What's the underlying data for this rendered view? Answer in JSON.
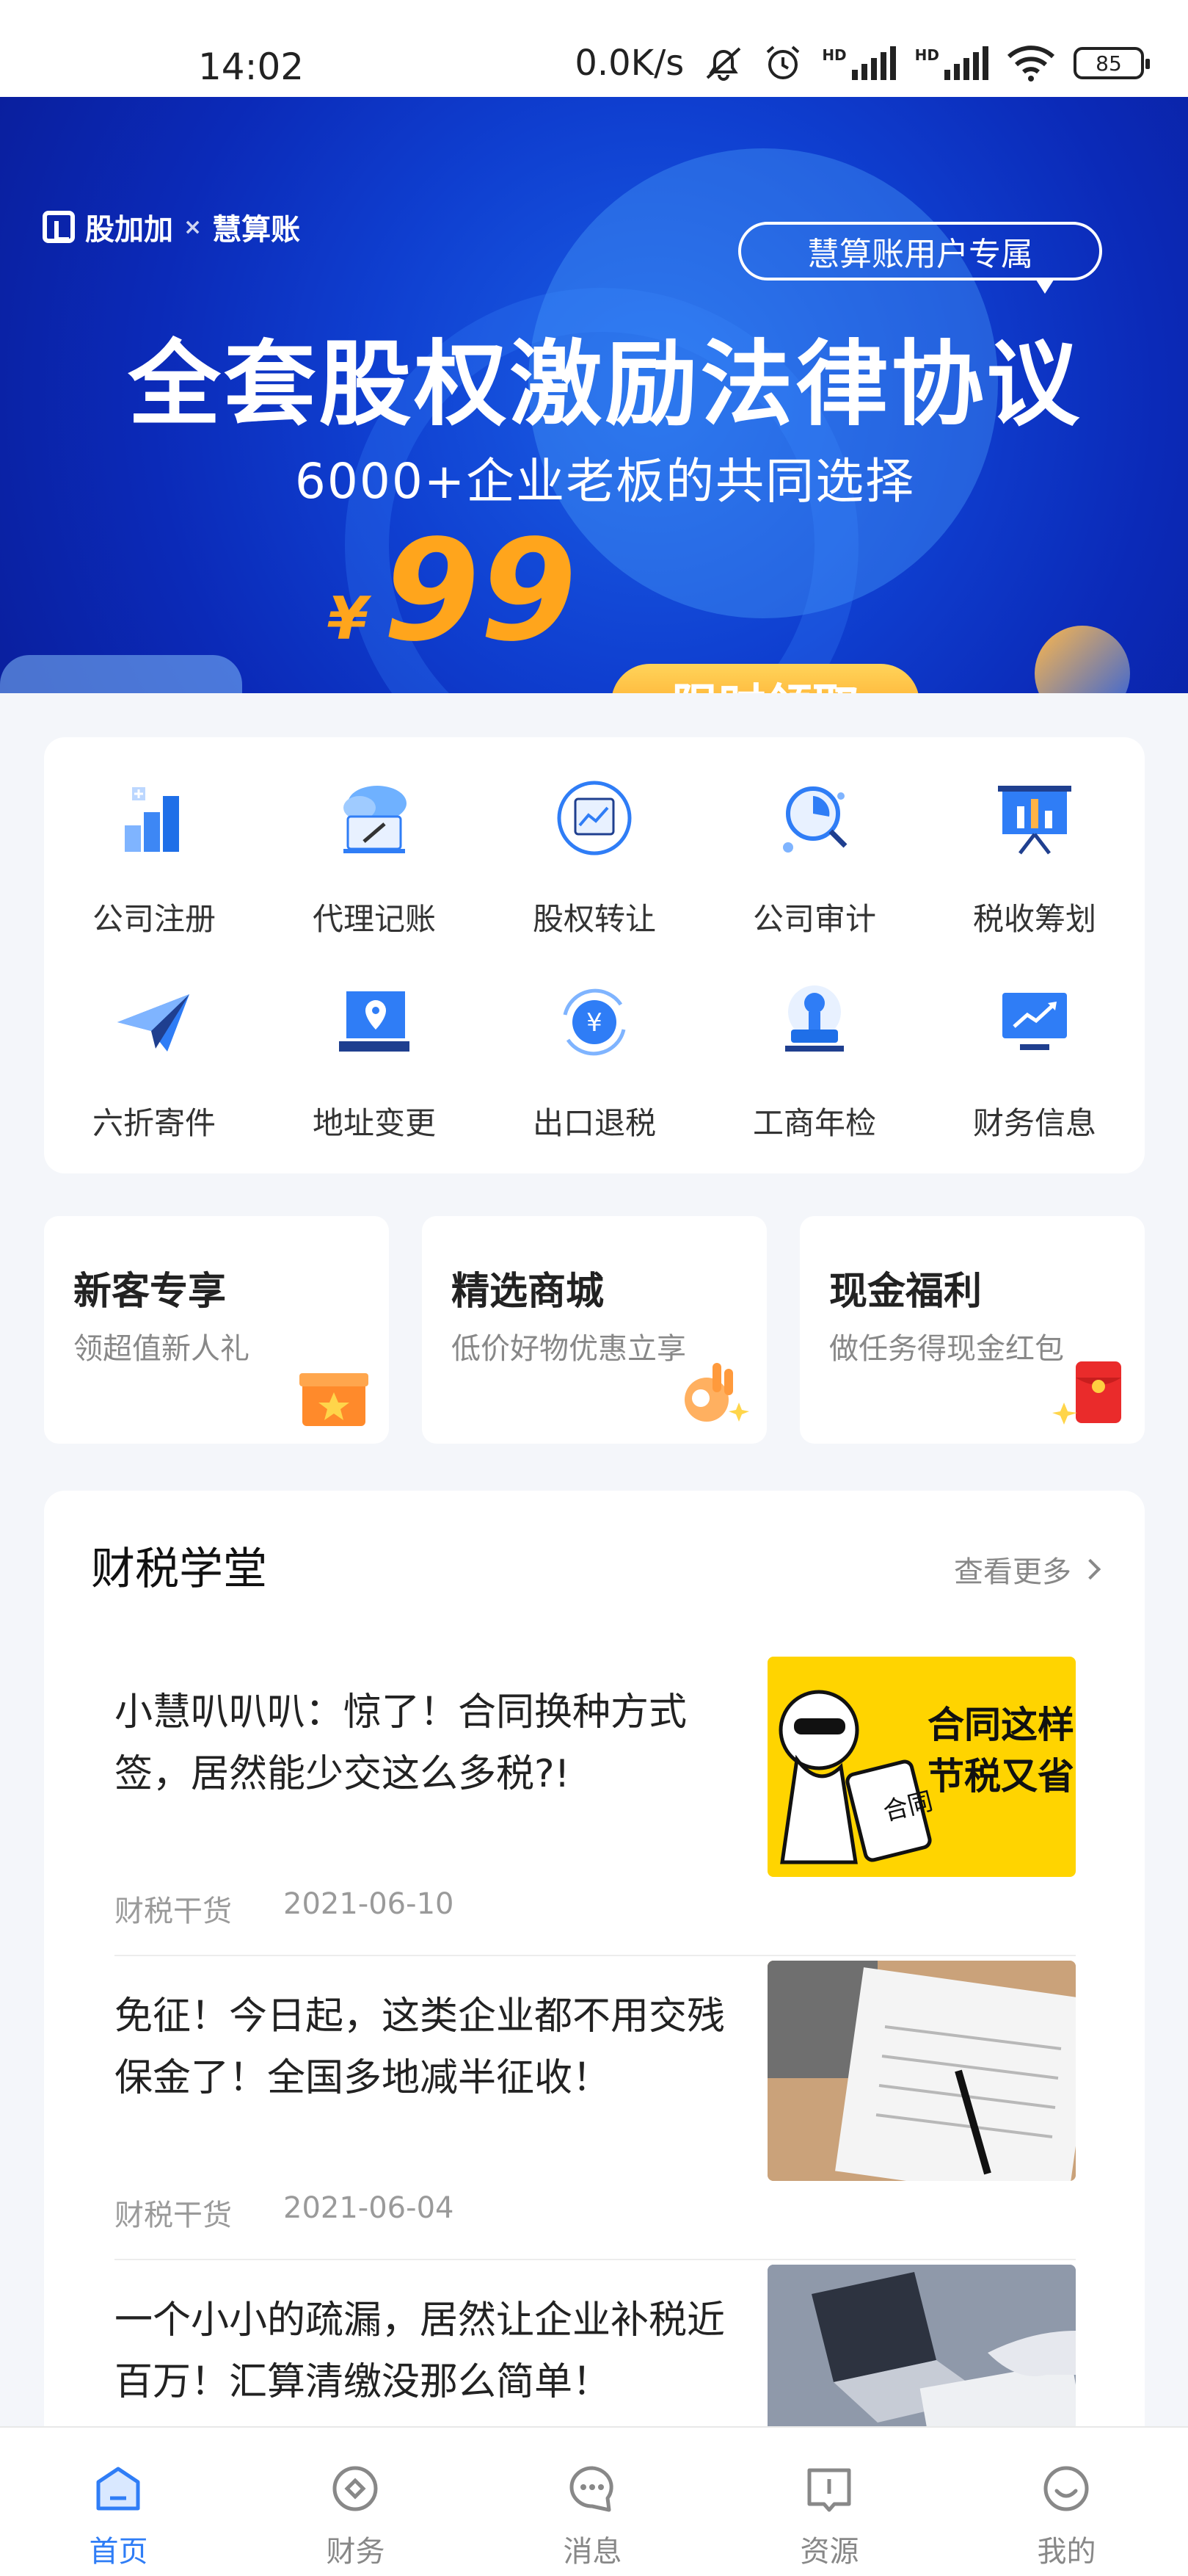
{
  "status_bar": {
    "time": "14:02",
    "net_speed": "0.0K/s",
    "sim1_tag": "HD",
    "sim2_tag": "HD",
    "battery": "85"
  },
  "banner": {
    "brand_left": "股加加",
    "brand_sep": "×",
    "brand_right": "慧算账",
    "badge": "慧算账用户专属",
    "headline": "全套股权激励法律协议",
    "subline": "6000+企业老板的共同选择",
    "currency": "¥",
    "price": "99",
    "cta": "限时领取"
  },
  "services": [
    {
      "label": "公司注册",
      "icon": "company-register-icon"
    },
    {
      "label": "代理记账",
      "icon": "bookkeeping-icon"
    },
    {
      "label": "股权转让",
      "icon": "equity-transfer-icon"
    },
    {
      "label": "公司审计",
      "icon": "audit-icon"
    },
    {
      "label": "税收筹划",
      "icon": "tax-planning-icon"
    },
    {
      "label": "六折寄件",
      "icon": "paper-plane-icon"
    },
    {
      "label": "地址变更",
      "icon": "address-change-icon"
    },
    {
      "label": "出口退税",
      "icon": "tax-refund-icon"
    },
    {
      "label": "工商年检",
      "icon": "annual-inspection-icon"
    },
    {
      "label": "财务信息",
      "icon": "finance-info-icon"
    }
  ],
  "promos": [
    {
      "title": "新客专享",
      "subtitle": "领超值新人礼",
      "icon": "gift-box-icon"
    },
    {
      "title": "精选商城",
      "subtitle": "低价好物优惠立享",
      "icon": "ok-hand-icon"
    },
    {
      "title": "现金福利",
      "subtitle": "做任务得现金红包",
      "icon": "red-envelope-icon"
    }
  ],
  "school": {
    "title": "财税学堂",
    "more": "查看更多",
    "articles": [
      {
        "title": "小慧叭叭叭：惊了！合同换种方式签，居然能少交这么多税?!",
        "category": "财税干货",
        "date": "2021-06-10",
        "thumb_text_1": "合同这样",
        "thumb_text_2": "节税又省",
        "thumb_tag": "合同"
      },
      {
        "title": "免征！今日起，这类企业都不用交残保金了！全国多地减半征收！",
        "category": "财税干货",
        "date": "2021-06-04"
      },
      {
        "title": "一个小小的疏漏，居然让企业补税近百万！汇算清缴没那么简单！",
        "category": "",
        "date": ""
      }
    ]
  },
  "tabbar": [
    {
      "label": "首页",
      "icon": "home-icon",
      "active": true
    },
    {
      "label": "财务",
      "icon": "finance-icon",
      "active": false
    },
    {
      "label": "消息",
      "icon": "message-icon",
      "active": false
    },
    {
      "label": "资源",
      "icon": "resource-icon",
      "active": false
    },
    {
      "label": "我的",
      "icon": "profile-icon",
      "active": false
    }
  ],
  "colors": {
    "primary": "#2f7df6",
    "banner_blue": "#0f3fd0",
    "price_orange": "#ffa51c",
    "thumb_yellow": "#ffd400"
  }
}
